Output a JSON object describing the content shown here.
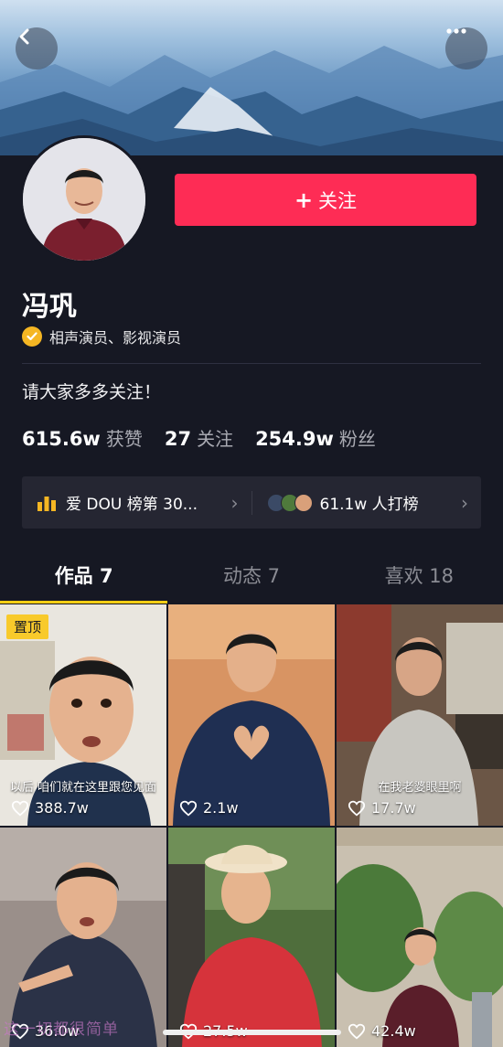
{
  "colors": {
    "accent": "#fe2c55",
    "tab_indicator": "#face15",
    "badge": "#f5b623",
    "pin": "#f8ca2b",
    "background": "#161823"
  },
  "header": {
    "back_icon": "chevron-left-icon",
    "more_icon": "more-dots-icon"
  },
  "profile": {
    "follow_label": "关注",
    "follow_plus": "+",
    "name": "冯巩",
    "verification": "相声演员、影视演员",
    "bio": "请大家多多关注！",
    "stats": [
      {
        "value": "615.6w",
        "label": "获赞"
      },
      {
        "value": "27",
        "label": "关注"
      },
      {
        "value": "254.9w",
        "label": "粉丝"
      }
    ],
    "rank_left": "爱 DOU 榜第 30...",
    "rank_right": "61.1w 人打榜"
  },
  "tabs": [
    {
      "label": "作品 7",
      "active": true
    },
    {
      "label": "动态 7",
      "active": false
    },
    {
      "label": "喜欢 18",
      "active": false
    }
  ],
  "videos": [
    {
      "likes": "388.7w",
      "pinned": "置顶",
      "caption": "以后 咱们就在这里跟您见面"
    },
    {
      "likes": "2.1w"
    },
    {
      "likes": "17.7w",
      "caption": "在我老婆眼里啊"
    },
    {
      "likes": "36.0w"
    },
    {
      "likes": "27.5w"
    },
    {
      "likes": "42.4w"
    }
  ],
  "watermark": "这一切都很简单"
}
